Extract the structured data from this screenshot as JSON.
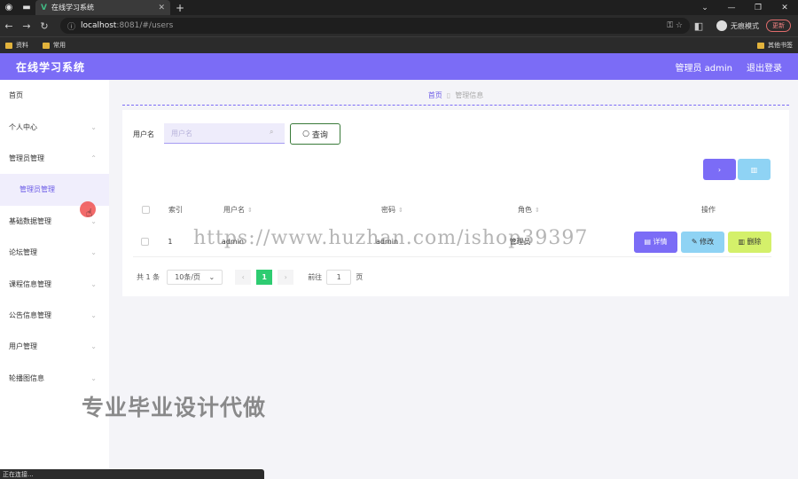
{
  "browser": {
    "tab_title": "在线学习系统",
    "url_host": "localhost",
    "url_path": ":8081/#/users",
    "incognito_label": "无痕模式",
    "update_label": "更新",
    "bookmarks": [
      "资料",
      "常用"
    ],
    "other_bookmarks": "其他书签",
    "status_text": "正在连接..."
  },
  "header": {
    "title": "在线学习系统",
    "user_label": "管理员 admin",
    "logout_label": "退出登录",
    "accent_color": "#7b6cf6"
  },
  "sidebar": {
    "items": [
      {
        "label": "首页"
      },
      {
        "label": "个人中心"
      },
      {
        "label": "管理员管理"
      },
      {
        "label": "管理员管理"
      },
      {
        "label": "基础数据管理"
      },
      {
        "label": "论坛管理"
      },
      {
        "label": "课程信息管理"
      },
      {
        "label": "公告信息管理"
      },
      {
        "label": "用户管理"
      },
      {
        "label": "轮播图信息"
      }
    ]
  },
  "breadcrumb": {
    "home": "首页",
    "current": "管理信息"
  },
  "search": {
    "label": "用户名",
    "placeholder": "用户名",
    "query_label": "查询"
  },
  "table": {
    "headers": [
      "索引",
      "用户名",
      "密码",
      "角色",
      "操作"
    ],
    "rows": [
      {
        "index": "1",
        "username": "admin",
        "password": "admin",
        "role": "管理员"
      }
    ],
    "actions": {
      "detail": "详情",
      "edit": "修改",
      "delete": "删除"
    }
  },
  "pagination": {
    "total": "共 1 条",
    "page_size": "10条/页",
    "current_page": "1",
    "goto_label": "前往",
    "goto_value": "1",
    "page_unit": "页"
  },
  "watermarks": {
    "url": "https://www.huzhan.com/ishop39397",
    "text": "专业毕业设计代做"
  }
}
